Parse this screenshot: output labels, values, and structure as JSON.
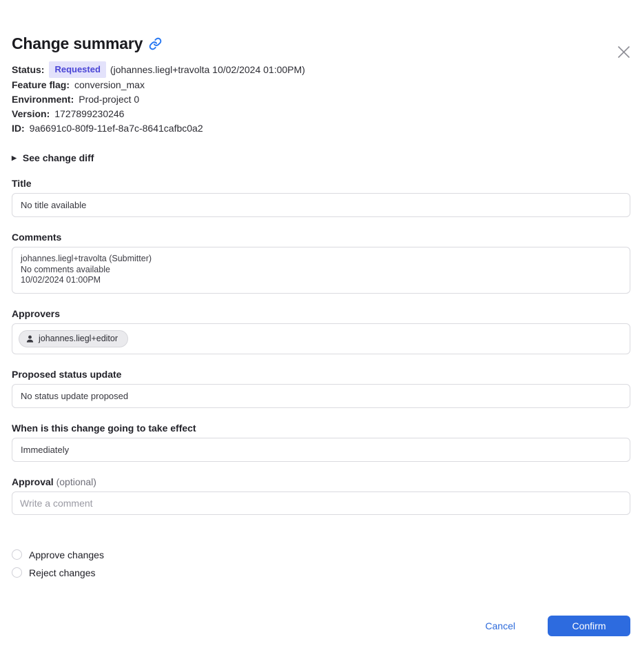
{
  "dialog": {
    "title": "Change summary"
  },
  "meta": {
    "status_label": "Status:",
    "status_badge": "Requested",
    "status_detail": "(johannes.liegl+travolta 10/02/2024 01:00PM)",
    "rows": [
      {
        "label": "Feature flag:",
        "value": "conversion_max"
      },
      {
        "label": "Environment:",
        "value": "Prod-project 0"
      },
      {
        "label": "Version:",
        "value": "1727899230246"
      },
      {
        "label": "ID:",
        "value": "9a6691c0-80f9-11ef-8a7c-8641cafbc0a2"
      }
    ]
  },
  "diff_toggle": {
    "label": "See change diff",
    "icon": "▶"
  },
  "sections": {
    "title": {
      "label": "Title",
      "value": "No title available"
    },
    "comments": {
      "label": "Comments",
      "lines": [
        "johannes.liegl+travolta (Submitter)",
        "No comments available",
        "10/02/2024 01:00PM"
      ]
    },
    "approvers": {
      "label": "Approvers",
      "chip": "johannes.liegl+editor"
    },
    "proposed_status": {
      "label": "Proposed status update",
      "value": "No status update proposed"
    },
    "effect": {
      "label": "When is this change going to take effect",
      "value": "Immediately"
    },
    "approval": {
      "label": "Approval",
      "optional": "(optional)",
      "placeholder": "Write a comment"
    }
  },
  "radios": [
    {
      "label": "Approve changes",
      "checked": false
    },
    {
      "label": "Reject changes",
      "checked": false
    }
  ],
  "footer": {
    "cancel": "Cancel",
    "confirm": "Confirm"
  },
  "colors": {
    "accent_blue": "#2d6bdf",
    "badge_bg": "#e3e2fb",
    "badge_text": "#4a45d6"
  }
}
